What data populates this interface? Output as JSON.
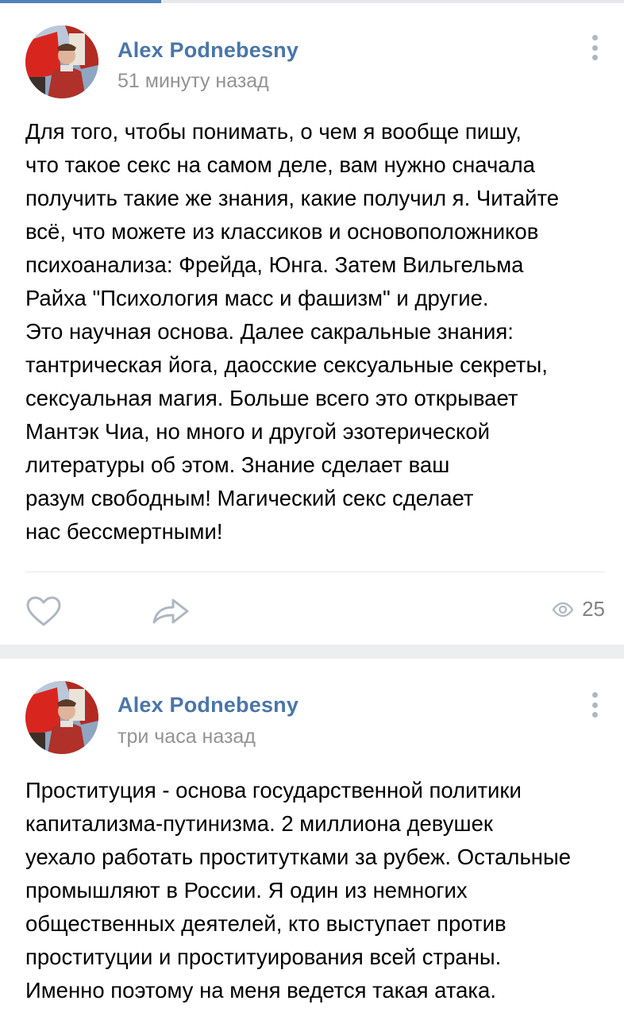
{
  "posts": [
    {
      "author": "Alex Podnebesny",
      "time": "51 минуту назад",
      "text": "Для того, чтобы понимать, о чем я вообще пишу,\nчто такое секс на самом деле, вам нужно сначала\nполучить такие же знания, какие получил я. Читайте\nвсё, что можете из классиков и основоположников\nпсихоанализа: Фрейда, Юнга. Затем Вильгельма\nРайха \"Психология масс и фашизм\" и другие.\nЭто научная основа. Далее сакральные знания:\nтантрическая йога, даосские сексуальные секреты,\nсексуальная магия. Больше всего это открывает\nМантэк Чиа, но много и другой эзотерической\nлитературы об этом. Знание сделает ваш\nразум свободным! Магический секс сделает\nнас бессмертными!",
      "views": "25"
    },
    {
      "author": "Alex Podnebesny",
      "time": "три часа назад",
      "text": "Проституция - основа государственной политики\nкапитализма-путинизма. 2 миллиона девушек\nуехало работать проститутками за рубеж. Остальные\nпромышляют в России. Я один из немногих\nобщественных деятелей, кто выступает против\nпроституции и проституирования всей страны.\nИменно поэтому на меня ведется такая атака."
    }
  ],
  "icons": {
    "like": "heart-icon",
    "share": "share-arrow-icon",
    "views": "eye-icon",
    "more": "more-vertical-icon"
  },
  "colors": {
    "author": "#4a76a8",
    "time": "#939393",
    "icon": "#aeb7c2",
    "separator": "#edeef0"
  }
}
